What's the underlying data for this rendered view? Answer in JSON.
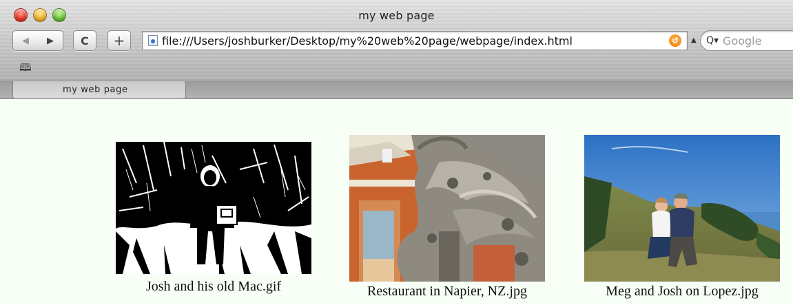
{
  "window": {
    "title": "my web page"
  },
  "toolbar": {
    "back_glyph": "◀",
    "forward_glyph": "▶",
    "reload_glyph": "C",
    "add_glyph": "+",
    "address": "file:///Users/joshburker/Desktop/my%20web%20page/webpage/index.html",
    "snapback_glyph": "↺",
    "search_placeholder": "Google",
    "search_glyph": "Q▾",
    "bookmarks_glyph": "🕮"
  },
  "tabs": [
    {
      "label": "my web page"
    }
  ],
  "gallery": {
    "items": [
      {
        "caption": "Josh and his old Mac.gif"
      },
      {
        "caption": "Restaurant in Napier, NZ.jpg"
      },
      {
        "caption": "Meg and Josh on Lopez.jpg"
      }
    ]
  },
  "colors": {
    "page_background": "#f7fff7",
    "sky": "#3d7dc6"
  }
}
